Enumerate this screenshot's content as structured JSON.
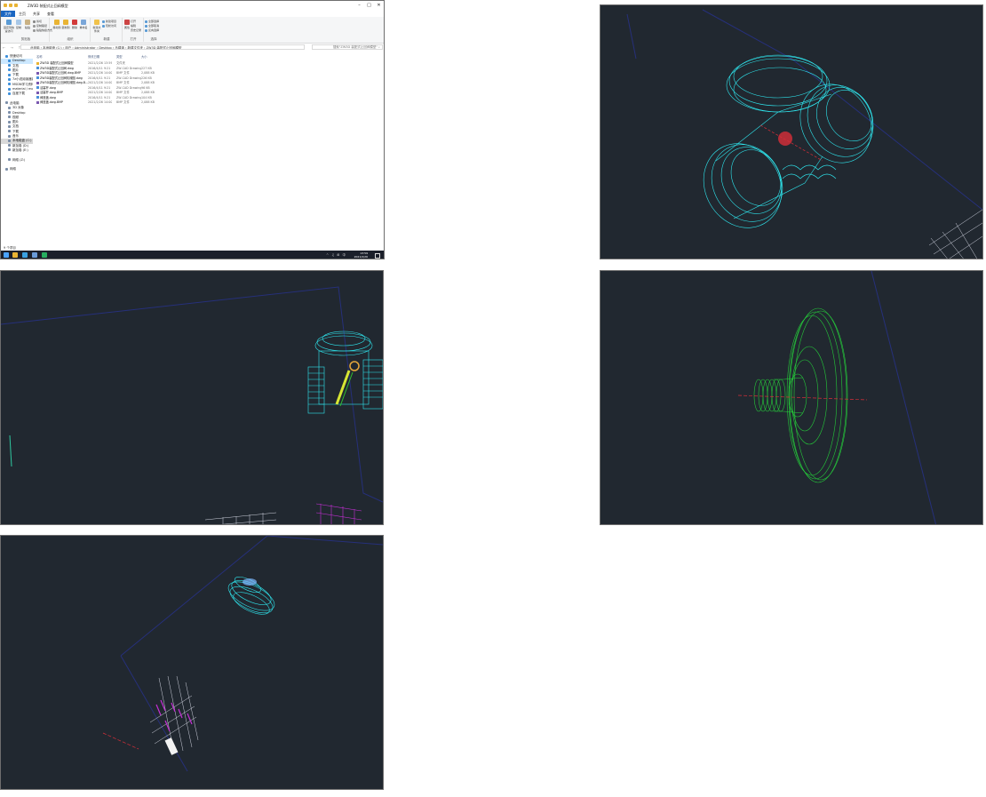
{
  "explorer": {
    "title": "ZW3D 装配式止回阀模型",
    "ribbon_tabs": [
      "文件",
      "主页",
      "共享",
      "查看"
    ],
    "ribbon_groups": {
      "clipboard": {
        "name": "剪贴板",
        "pin": "固定到快速访问",
        "copy": "复制",
        "paste": "粘贴",
        "cut": "剪切",
        "copy_path": "复制路径",
        "paste_shortcut": "粘贴快捷方式"
      },
      "organize": {
        "name": "组织",
        "move_to": "移动到",
        "copy_to": "复制到",
        "delete": "删除",
        "rename": "重命名"
      },
      "new": {
        "name": "新建",
        "new_folder": "新建文件夹",
        "new_item": "新建项目",
        "easy_access": "轻松访问"
      },
      "open": {
        "name": "打开",
        "properties": "属性",
        "open": "打开",
        "edit": "编辑",
        "history": "历史记录"
      },
      "select": {
        "name": "选择",
        "select_all": "全部选择",
        "select_none": "全部取消",
        "invert": "反向选择"
      }
    },
    "address": {
      "nav": "← → ↑",
      "path": "此电脑 › 本地磁盘 (C:) › 用户 › Administrator › Desktop › 马建清 › 新建文件夹 › ZW3D 装配式止回阀模型",
      "search_placeholder": "搜索\"ZW3D 装配式止回阀模型\" ⌕"
    },
    "nav_items": [
      {
        "label": "快速访问",
        "indent": false,
        "selected": false
      },
      {
        "label": "Desktop",
        "indent": true,
        "selected": true
      },
      {
        "label": "文档",
        "indent": true,
        "selected": false
      },
      {
        "label": "图片",
        "indent": true,
        "selected": false
      },
      {
        "label": "下载",
        "indent": true,
        "selected": false
      },
      {
        "label": "7z小说阅读器源码",
        "indent": true,
        "selected": false
      },
      {
        "label": "MSDN学习资料源",
        "indent": true,
        "selected": false
      },
      {
        "label": "material / model",
        "indent": true,
        "selected": false
      },
      {
        "label": "百度下载",
        "indent": true,
        "selected": false
      },
      {
        "label": "",
        "indent": false,
        "selected": false
      },
      {
        "label": "此电脑",
        "indent": false,
        "selected": false
      },
      {
        "label": "3D 对象",
        "indent": true,
        "selected": false
      },
      {
        "label": "Desktop",
        "indent": true,
        "selected": false
      },
      {
        "label": "视频",
        "indent": true,
        "selected": false
      },
      {
        "label": "图片",
        "indent": true,
        "selected": false
      },
      {
        "label": "文档",
        "indent": true,
        "selected": false
      },
      {
        "label": "下载",
        "indent": true,
        "selected": false
      },
      {
        "label": "音乐",
        "indent": true,
        "selected": false
      },
      {
        "label": "本地磁盘 (C:)",
        "indent": true,
        "selected": true
      },
      {
        "label": "新加卷 (D:)",
        "indent": true,
        "selected": false
      },
      {
        "label": "新加卷 (E:)",
        "indent": true,
        "selected": false
      },
      {
        "label": "",
        "indent": false,
        "selected": false
      },
      {
        "label": "网络 (Z:)",
        "indent": true,
        "selected": false
      },
      {
        "label": "",
        "indent": false,
        "selected": false
      },
      {
        "label": "网络",
        "indent": false,
        "selected": false
      }
    ],
    "columns": {
      "name": "名称",
      "date": "修改日期",
      "type": "类型",
      "size": "大小"
    },
    "files": [
      {
        "name": "ZW3D 装配式止回阀模型",
        "date": "2021/2/26 13:59",
        "type": "文件夹",
        "size": "",
        "color": "#e9b434"
      },
      {
        "name": "ZW3D装配式止回阀.dwg",
        "date": "2016/4/11 9:21",
        "type": "ZW-CAD Drawing",
        "size": "227 KB",
        "color": "#4a90d9"
      },
      {
        "name": "ZW3D装配式止回阀.dwg.BMP",
        "date": "2021/2/26 14:00",
        "type": "BMP 文件",
        "size": "2,088 KB",
        "color": "#7a58b0"
      },
      {
        "name": "ZW3D装配式止回阀机械图.dwg",
        "date": "2016/4/11 9:21",
        "type": "ZW-CAD Drawing",
        "size": "226 KB",
        "color": "#4a90d9"
      },
      {
        "name": "ZW3D装配式止回阀机械图.dwg.B...",
        "date": "2021/2/26 14:00",
        "type": "BMP 文件",
        "size": "2,088 KB",
        "color": "#7a58b0"
      },
      {
        "name": "活塞杆.dwg",
        "date": "2016/4/11 9:21",
        "type": "ZW-CAD Drawing",
        "size": "96 KB",
        "color": "#4a90d9"
      },
      {
        "name": "活塞杆.dwg.BMP",
        "date": "2021/2/26 14:00",
        "type": "BMP 文件",
        "size": "2,088 KB",
        "color": "#7a58b0"
      },
      {
        "name": "阀座盖.dwg",
        "date": "2016/4/11 9:21",
        "type": "ZW-CAD Drawing",
        "size": "104 KB",
        "color": "#4a90d9"
      },
      {
        "name": "阀座盖.dwg.BMP",
        "date": "2021/2/26 14:00",
        "type": "BMP 文件",
        "size": "2,088 KB",
        "color": "#7a58b0"
      }
    ],
    "status": "9 个项目",
    "taskbar": {
      "tray_icons": "^ ♫ ⊞ 中",
      "time": "13:59",
      "date": "2021/2/26"
    }
  },
  "viewports": [
    {
      "name": "assembly-valve-top-view",
      "color": "#2fe6ee"
    },
    {
      "name": "assembly-valve-front-view",
      "color": "#2fe6ee"
    },
    {
      "name": "valve-seat-cover-view",
      "color": "#25c93a"
    },
    {
      "name": "piston-rod-view",
      "color": "#2fe6ee"
    }
  ]
}
